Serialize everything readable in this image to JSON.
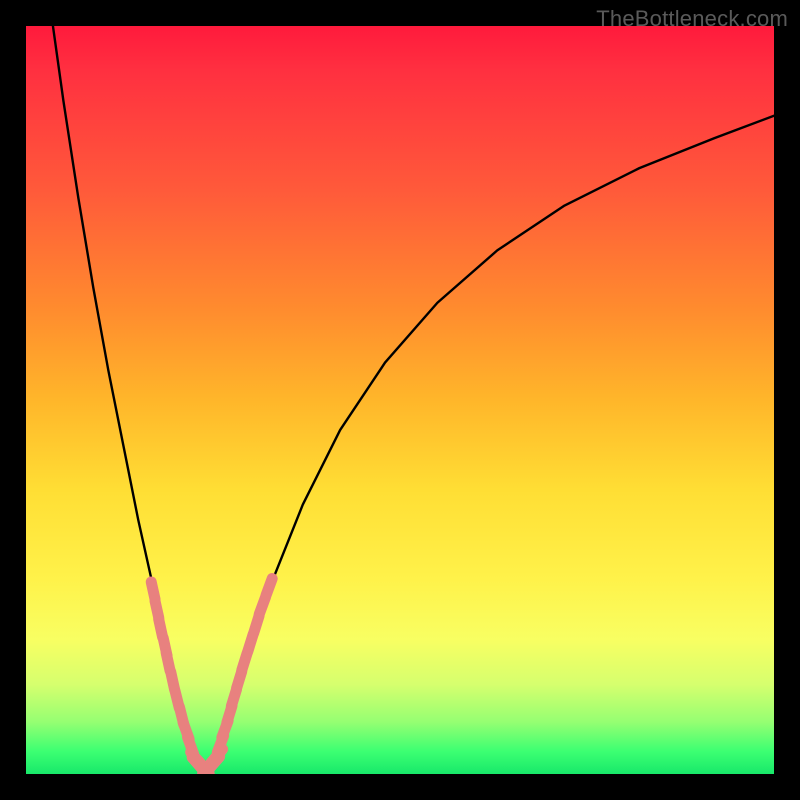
{
  "watermark": "TheBottleneck.com",
  "chart_data": {
    "type": "line",
    "title": "",
    "xlabel": "",
    "ylabel": "",
    "xlim": [
      0,
      100
    ],
    "ylim": [
      0,
      100
    ],
    "series": [
      {
        "name": "bottleneck-curve",
        "x": [
          3.6,
          5,
          7,
          9,
          11,
          13,
          15,
          17,
          19,
          20.5,
          22,
          23.4,
          24.6,
          26,
          28,
          30,
          33,
          37,
          42,
          48,
          55,
          63,
          72,
          82,
          92,
          100
        ],
        "y": [
          100,
          90,
          77,
          65,
          54,
          44,
          34,
          25,
          16,
          9,
          4,
          1,
          1,
          4,
          10,
          17,
          26,
          36,
          46,
          55,
          63,
          70,
          76,
          81,
          85,
          88
        ]
      }
    ],
    "dash_clusters": [
      {
        "name": "left-cluster",
        "points": [
          {
            "x": 17.0,
            "y": 24.5
          },
          {
            "x": 17.5,
            "y": 22.0
          },
          {
            "x": 18.0,
            "y": 19.5
          },
          {
            "x": 18.6,
            "y": 17.0
          },
          {
            "x": 19.0,
            "y": 15.0
          },
          {
            "x": 19.6,
            "y": 12.5
          },
          {
            "x": 20.2,
            "y": 10.0
          },
          {
            "x": 20.8,
            "y": 7.8
          },
          {
            "x": 21.4,
            "y": 5.8
          },
          {
            "x": 22.0,
            "y": 3.8
          },
          {
            "x": 22.8,
            "y": 2.0
          }
        ]
      },
      {
        "name": "bottom-cluster",
        "points": [
          {
            "x": 23.0,
            "y": 1.3
          },
          {
            "x": 23.7,
            "y": 1.0
          },
          {
            "x": 24.4,
            "y": 1.0
          },
          {
            "x": 25.1,
            "y": 1.4
          }
        ]
      },
      {
        "name": "right-cluster",
        "points": [
          {
            "x": 25.5,
            "y": 2.4
          },
          {
            "x": 26.0,
            "y": 4.0
          },
          {
            "x": 26.6,
            "y": 6.0
          },
          {
            "x": 27.2,
            "y": 8.0
          },
          {
            "x": 27.8,
            "y": 10.2
          },
          {
            "x": 28.5,
            "y": 12.6
          },
          {
            "x": 29.2,
            "y": 15.0
          },
          {
            "x": 30.0,
            "y": 17.5
          },
          {
            "x": 30.8,
            "y": 20.0
          },
          {
            "x": 31.6,
            "y": 22.5
          },
          {
            "x": 32.5,
            "y": 25.0
          }
        ]
      }
    ],
    "colors": {
      "curve": "#000000",
      "dash": "#e8817f"
    }
  }
}
